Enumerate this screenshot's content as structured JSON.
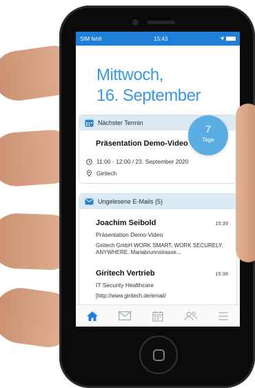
{
  "statusbar": {
    "carrier": "SIM fehlt",
    "time": "15:43"
  },
  "header": {
    "weekday": "Mittwoch,",
    "date": "16. September"
  },
  "next_appointment": {
    "section_title": "Nächster Termin",
    "title": "Präsentation Demo-Video",
    "time": "11:00 - 12:00 / 23. September 2020",
    "location": "Giritech",
    "days_count": "7",
    "days_label": "Tage"
  },
  "unread_emails": {
    "section_title": "Ungelesene E-Mails (5)",
    "items": [
      {
        "sender": "Joachim Seibold",
        "time": "15:39",
        "subject": "Präsentation Demo-Video",
        "preview": "Giritech GmbH WORK SMART, WORK SECURELY. ANYWHERE. Mariabrunnstrasse..."
      },
      {
        "sender": "Giritech Vertrieb",
        "time": "15:38",
        "subject": "IT Security Healthcare",
        "preview": "[http://www.giritech.de/email/"
      }
    ]
  },
  "tabbar": {
    "tabs": [
      "home-icon",
      "mail-icon",
      "calendar-icon",
      "contacts-icon",
      "menu-icon"
    ],
    "active_color": "#1e7fd8",
    "inactive_color": "#9aa3ab"
  }
}
